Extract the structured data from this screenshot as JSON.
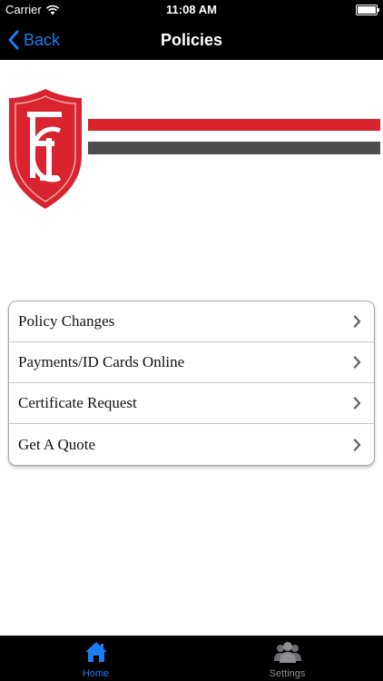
{
  "status_bar": {
    "carrier": "Carrier",
    "time": "11:08 AM"
  },
  "nav": {
    "back_label": "Back",
    "title": "Policies"
  },
  "logo": {
    "shield_color": "#d9232e",
    "red_bar_color": "#d9232e",
    "gray_bar_color": "#4d4d4d"
  },
  "menu": {
    "items": [
      {
        "label": "Policy Changes"
      },
      {
        "label": "Payments/ID Cards Online"
      },
      {
        "label": "Certificate Request"
      },
      {
        "label": "Get A Quote"
      }
    ]
  },
  "tab_bar": {
    "active_color": "#1e7df0",
    "inactive_color": "#8e8e93",
    "tabs": [
      {
        "label": "Home",
        "icon": "home-icon"
      },
      {
        "label": "Settings",
        "icon": "users-icon"
      }
    ]
  }
}
